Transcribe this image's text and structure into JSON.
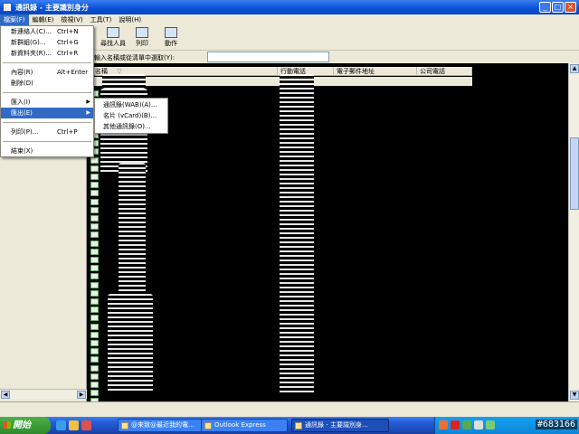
{
  "window": {
    "title": "通訊錄 - 主要識別身分",
    "controls": [
      "_",
      "□",
      "×"
    ]
  },
  "menubar": [
    {
      "label": "檔案(F)",
      "active": true
    },
    {
      "label": "編輯(E)"
    },
    {
      "label": "檢視(V)"
    },
    {
      "label": "工具(T)"
    },
    {
      "label": "說明(H)"
    }
  ],
  "toolbar": [
    {
      "label": "尋找人員",
      "icon": "find-people-icon"
    },
    {
      "label": "列印",
      "icon": "printer-icon"
    },
    {
      "label": "動作",
      "icon": "action-icon"
    }
  ],
  "search": {
    "label": "輸入名稱或從清單中選取(Y):",
    "value": ""
  },
  "columns": [
    {
      "label": "名稱",
      "sort": "▽"
    },
    {
      "label": "行動電話"
    },
    {
      "label": "電子郵件地址"
    },
    {
      "label": "公司電話"
    }
  ],
  "file_menu": {
    "items": [
      {
        "label": "新連絡人(C)...",
        "shortcut": "Ctrl+N"
      },
      {
        "label": "新群組(G)...",
        "shortcut": "Ctrl+G"
      },
      {
        "label": "新資料夾(R)...",
        "shortcut": "Ctrl+R"
      },
      {
        "sep": true
      },
      {
        "label": "內容(R)",
        "shortcut": "Alt+Enter"
      },
      {
        "label": "刪除(D)",
        "shortcut": ""
      },
      {
        "sep": true
      },
      {
        "label": "匯入(I)",
        "submenu": true
      },
      {
        "label": "匯出(E)",
        "submenu": true,
        "active": true
      },
      {
        "sep": true
      },
      {
        "label": "列印(P)...",
        "shortcut": "Ctrl+P"
      },
      {
        "sep": true
      },
      {
        "label": "結束(X)",
        "shortcut": ""
      }
    ]
  },
  "export_submenu": [
    {
      "label": "通訊錄(WAB)(A)..."
    },
    {
      "label": "名片 (vCard)(B)..."
    },
    {
      "label": "其他通訊錄(O)..."
    }
  ],
  "taskbar": {
    "start_label": "開始",
    "tasks": [
      {
        "label": "@來致@最近我的電..."
      },
      {
        "label": "Outlook Express"
      },
      {
        "label": "通訊錄 - 主要識別身...",
        "active": true
      }
    ],
    "tray_text": "#683166"
  }
}
